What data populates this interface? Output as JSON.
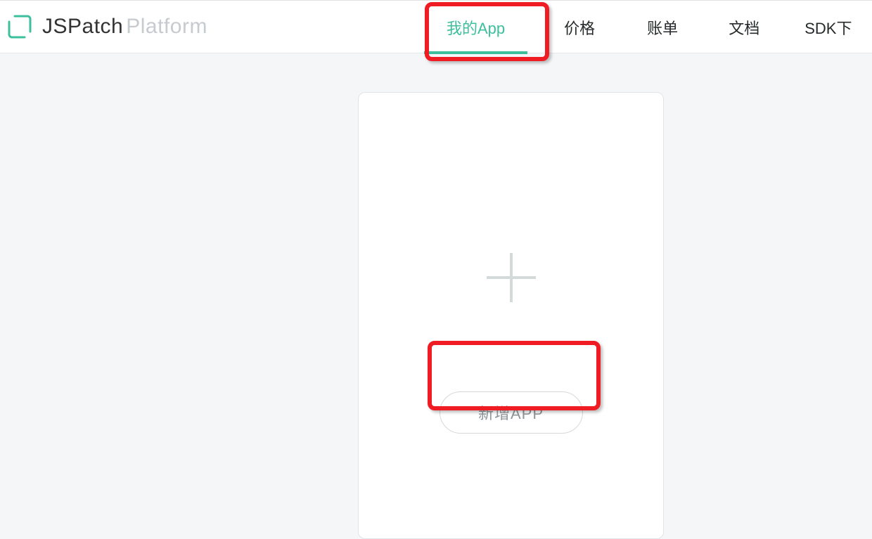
{
  "brand": {
    "name": "JSPatch",
    "suffix": "Platform"
  },
  "nav": {
    "items": [
      {
        "label": "我的App",
        "active": true
      },
      {
        "label": "价格",
        "active": false
      },
      {
        "label": "账单",
        "active": false
      },
      {
        "label": "文档",
        "active": false
      },
      {
        "label": "SDK下",
        "active": false
      }
    ]
  },
  "card": {
    "add_button_label": "新增APP"
  },
  "colors": {
    "accent": "#3cbf9d",
    "highlight": "#ef1c24"
  }
}
